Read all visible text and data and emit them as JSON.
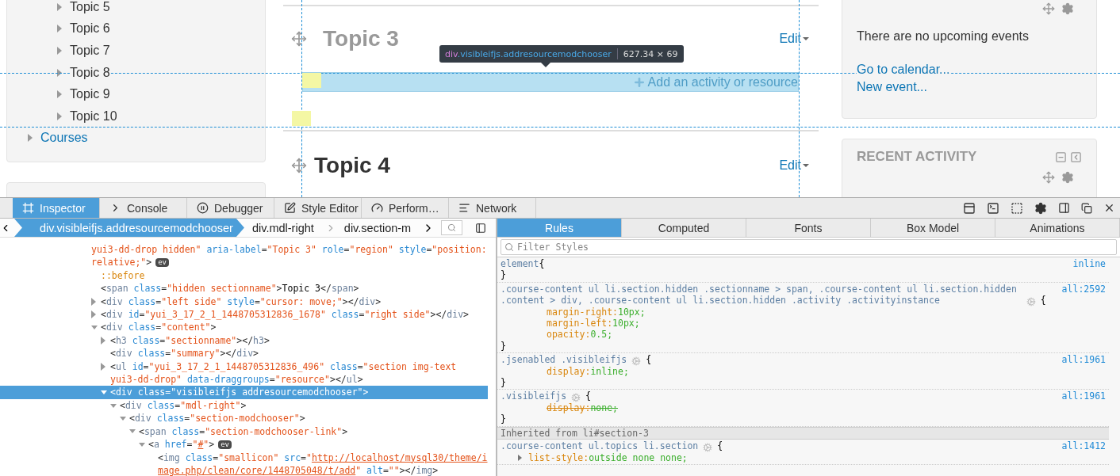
{
  "page": {
    "nav": {
      "topics": [
        {
          "label": "Topic 5",
          "expanded": false
        },
        {
          "label": "Topic 6",
          "expanded": false
        },
        {
          "label": "Topic 7",
          "expanded": false
        },
        {
          "label": "Topic 8",
          "expanded": false
        },
        {
          "label": "Topic 9",
          "expanded": false
        },
        {
          "label": "Topic 10",
          "expanded": false
        }
      ],
      "courses": {
        "label": "Courses",
        "expanded": false
      }
    },
    "sections": [
      {
        "title": "Topic 3",
        "hidden": true,
        "edit": "Edit",
        "add_activity": "Add an activity or resource"
      },
      {
        "title": "Topic 4",
        "hidden": false,
        "edit": "Edit"
      }
    ],
    "highlight": {
      "tag": "div",
      "classes": ".visibleifjs.addresourcemodchooser",
      "size": "627.34 × 69"
    },
    "blocks": [
      {
        "kind": "calendar",
        "message": "There are no upcoming events",
        "links": [
          "Go to calendar...",
          "New event..."
        ]
      },
      {
        "kind": "recent",
        "title": "RECENT ACTIVITY"
      }
    ]
  },
  "devtools": {
    "tools": [
      {
        "label": "Inspector",
        "selected": true
      },
      {
        "label": "Console",
        "selected": false
      },
      {
        "label": "Debugger",
        "selected": false
      },
      {
        "label": "Style Editor",
        "selected": false
      },
      {
        "label": "Perform…",
        "selected": false
      },
      {
        "label": "Network",
        "selected": false
      }
    ],
    "breadcrumbs": [
      {
        "label": "div.visibleifjs.addresourcemodchooser",
        "selected": true
      },
      {
        "label": "div.mdl-right",
        "selected": false
      },
      {
        "label": "div.section-m",
        "selected": false
      }
    ],
    "sidebar_tabs": [
      {
        "label": "Rules",
        "selected": true
      },
      {
        "label": "Computed",
        "selected": false
      },
      {
        "label": "Fonts",
        "selected": false
      },
      {
        "label": "Box Model",
        "selected": false
      },
      {
        "label": "Animations",
        "selected": false
      }
    ],
    "filter": {
      "placeholder": "Filter Styles"
    },
    "markup": {
      "parts": [
        {
          "kind": "value",
          "text": "yui3-dd-drop hidden\""
        },
        {
          "kind": "attr",
          "text": " aria-label"
        },
        {
          "kind": "punct",
          "text": "="
        },
        {
          "kind": "value",
          "text": "\"Topic 3\""
        },
        {
          "kind": "attr",
          "text": " role"
        },
        {
          "kind": "punct",
          "text": "="
        },
        {
          "kind": "value",
          "text": "\"region\""
        },
        {
          "kind": "attr",
          "text": " style"
        },
        {
          "kind": "punct",
          "text": "="
        },
        {
          "kind": "value",
          "text": "\"position: relative;\""
        },
        {
          "kind": "punct",
          "text": ">"
        },
        {
          "kind": "badge",
          "text": "ev"
        }
      ],
      "selected": false,
      "children": [
        {
          "parts": [
            {
              "kind": "pseudo",
              "text": "::before"
            }
          ],
          "selected": false
        },
        {
          "parts": [
            {
              "kind": "punct",
              "text": "<"
            },
            {
              "kind": "tag",
              "text": "span"
            },
            {
              "kind": "attr",
              "text": " class"
            },
            {
              "kind": "punct",
              "text": "="
            },
            {
              "kind": "value",
              "text": "\"hidden sectionname\""
            },
            {
              "kind": "punct",
              "text": ">"
            },
            {
              "kind": "text",
              "text": "Topic 3"
            },
            {
              "kind": "punct",
              "text": "</"
            },
            {
              "kind": "tag",
              "text": "span"
            },
            {
              "kind": "punct",
              "text": ">"
            }
          ],
          "selected": false
        },
        {
          "parts": [
            {
              "kind": "punct",
              "text": "<"
            },
            {
              "kind": "tag",
              "text": "div"
            },
            {
              "kind": "attr",
              "text": " class"
            },
            {
              "kind": "punct",
              "text": "="
            },
            {
              "kind": "value",
              "text": "\"left side\""
            },
            {
              "kind": "attr",
              "text": " style"
            },
            {
              "kind": "punct",
              "text": "="
            },
            {
              "kind": "value",
              "text": "\"cursor: move;\""
            },
            {
              "kind": "punct",
              "text": "></"
            },
            {
              "kind": "tag",
              "text": "div"
            },
            {
              "kind": "punct",
              "text": ">"
            }
          ],
          "expanded": false,
          "selected": false
        },
        {
          "parts": [
            {
              "kind": "punct",
              "text": "<"
            },
            {
              "kind": "tag",
              "text": "div"
            },
            {
              "kind": "attr",
              "text": " id"
            },
            {
              "kind": "punct",
              "text": "="
            },
            {
              "kind": "value",
              "text": "\"yui_3_17_2_1_1448705312836_1678\""
            },
            {
              "kind": "attr",
              "text": " class"
            },
            {
              "kind": "punct",
              "text": "="
            },
            {
              "kind": "value",
              "text": "\"right side\""
            },
            {
              "kind": "punct",
              "text": "></"
            },
            {
              "kind": "tag",
              "text": "div"
            },
            {
              "kind": "punct",
              "text": ">"
            }
          ],
          "expanded": false,
          "selected": false
        },
        {
          "parts": [
            {
              "kind": "punct",
              "text": "<"
            },
            {
              "kind": "tag",
              "text": "div"
            },
            {
              "kind": "attr",
              "text": " class"
            },
            {
              "kind": "punct",
              "text": "="
            },
            {
              "kind": "value",
              "text": "\"content\""
            },
            {
              "kind": "punct",
              "text": ">"
            }
          ],
          "expanded": true,
          "selected": false,
          "children": [
            {
              "parts": [
                {
                  "kind": "punct",
                  "text": "<"
                },
                {
                  "kind": "tag",
                  "text": "h3"
                },
                {
                  "kind": "attr",
                  "text": " class"
                },
                {
                  "kind": "punct",
                  "text": "="
                },
                {
                  "kind": "value",
                  "text": "\"sectionname\""
                },
                {
                  "kind": "punct",
                  "text": "></"
                },
                {
                  "kind": "tag",
                  "text": "h3"
                },
                {
                  "kind": "punct",
                  "text": ">"
                }
              ],
              "expanded": false,
              "selected": false
            },
            {
              "parts": [
                {
                  "kind": "punct",
                  "text": "<"
                },
                {
                  "kind": "tag",
                  "text": "div"
                },
                {
                  "kind": "attr",
                  "text": " class"
                },
                {
                  "kind": "punct",
                  "text": "="
                },
                {
                  "kind": "value",
                  "text": "\"summary\""
                },
                {
                  "kind": "punct",
                  "text": "></"
                },
                {
                  "kind": "tag",
                  "text": "div"
                },
                {
                  "kind": "punct",
                  "text": ">"
                }
              ],
              "selected": false
            },
            {
              "parts": [
                {
                  "kind": "punct",
                  "text": "<"
                },
                {
                  "kind": "tag",
                  "text": "ul"
                },
                {
                  "kind": "attr",
                  "text": " id"
                },
                {
                  "kind": "punct",
                  "text": "="
                },
                {
                  "kind": "value",
                  "text": "\"yui_3_17_2_1_1448705312836_496\""
                },
                {
                  "kind": "attr",
                  "text": " class"
                },
                {
                  "kind": "punct",
                  "text": "="
                },
                {
                  "kind": "value",
                  "text": "\"section img-text yui3-dd-drop\""
                },
                {
                  "kind": "attr",
                  "text": " data-draggroups"
                },
                {
                  "kind": "punct",
                  "text": "="
                },
                {
                  "kind": "value",
                  "text": "\"resource\""
                },
                {
                  "kind": "punct",
                  "text": "></"
                },
                {
                  "kind": "tag",
                  "text": "ul"
                },
                {
                  "kind": "punct",
                  "text": ">"
                }
              ],
              "expanded": false,
              "selected": false
            },
            {
              "parts": [
                {
                  "kind": "punct",
                  "text": "<"
                },
                {
                  "kind": "tag",
                  "text": "div"
                },
                {
                  "kind": "attr",
                  "text": " class"
                },
                {
                  "kind": "punct",
                  "text": "="
                },
                {
                  "kind": "value",
                  "text": "\"visibleifjs addresourcemodchooser\""
                },
                {
                  "kind": "punct",
                  "text": ">"
                }
              ],
              "expanded": true,
              "selected": true,
              "children": [
                {
                  "parts": [
                    {
                      "kind": "punct",
                      "text": "<"
                    },
                    {
                      "kind": "tag",
                      "text": "div"
                    },
                    {
                      "kind": "attr",
                      "text": " class"
                    },
                    {
                      "kind": "punct",
                      "text": "="
                    },
                    {
                      "kind": "value",
                      "text": "\"mdl-right\""
                    },
                    {
                      "kind": "punct",
                      "text": ">"
                    }
                  ],
                  "expanded": true,
                  "selected": false,
                  "children": [
                    {
                      "parts": [
                        {
                          "kind": "punct",
                          "text": "<"
                        },
                        {
                          "kind": "tag",
                          "text": "div"
                        },
                        {
                          "kind": "attr",
                          "text": " class"
                        },
                        {
                          "kind": "punct",
                          "text": "="
                        },
                        {
                          "kind": "value",
                          "text": "\"section-modchooser\""
                        },
                        {
                          "kind": "punct",
                          "text": ">"
                        }
                      ],
                      "expanded": true,
                      "selected": false,
                      "children": [
                        {
                          "parts": [
                            {
                              "kind": "punct",
                              "text": "<"
                            },
                            {
                              "kind": "tag",
                              "text": "span"
                            },
                            {
                              "kind": "attr",
                              "text": " class"
                            },
                            {
                              "kind": "punct",
                              "text": "="
                            },
                            {
                              "kind": "value",
                              "text": "\"section-modchooser-link\""
                            },
                            {
                              "kind": "punct",
                              "text": ">"
                            }
                          ],
                          "expanded": true,
                          "selected": false,
                          "children": [
                            {
                              "parts": [
                                {
                                  "kind": "punct",
                                  "text": "<"
                                },
                                {
                                  "kind": "tag",
                                  "text": "a"
                                },
                                {
                                  "kind": "attr",
                                  "text": " href"
                                },
                                {
                                  "kind": "punct",
                                  "text": "="
                                },
                                {
                                  "kind": "value",
                                  "text": "\""
                                },
                                {
                                  "kind": "link",
                                  "text": "#"
                                },
                                {
                                  "kind": "value",
                                  "text": "\""
                                },
                                {
                                  "kind": "punct",
                                  "text": ">"
                                },
                                {
                                  "kind": "badge",
                                  "text": "ev"
                                }
                              ],
                              "expanded": true,
                              "selected": false,
                              "children": [
                                {
                                  "parts": [
                                    {
                                      "kind": "punct",
                                      "text": "<"
                                    },
                                    {
                                      "kind": "tag",
                                      "text": "img"
                                    },
                                    {
                                      "kind": "attr",
                                      "text": " class"
                                    },
                                    {
                                      "kind": "punct",
                                      "text": "="
                                    },
                                    {
                                      "kind": "value",
                                      "text": "\"smallicon\""
                                    },
                                    {
                                      "kind": "attr",
                                      "text": " src"
                                    },
                                    {
                                      "kind": "punct",
                                      "text": "="
                                    },
                                    {
                                      "kind": "value",
                                      "text": "\""
                                    },
                                    {
                                      "kind": "link",
                                      "text": "http://localhost/mysql30/theme/image.php/clean/core/1448705048/t/add"
                                    },
                                    {
                                      "kind": "value",
                                      "text": "\""
                                    },
                                    {
                                      "kind": "attr",
                                      "text": " alt"
                                    },
                                    {
                                      "kind": "punct",
                                      "text": "="
                                    },
                                    {
                                      "kind": "value",
                                      "text": "\"\""
                                    },
                                    {
                                      "kind": "punct",
                                      "text": "></"
                                    },
                                    {
                                      "kind": "tag",
                                      "text": "img"
                                    },
                                    {
                                      "kind": "punct",
                                      "text": ">"
                                    }
                                  ],
                                  "selected": false
                                }
                              ]
                            }
                          ]
                        }
                      ]
                    }
                  ]
                }
              ]
            }
          ]
        }
      ]
    },
    "rules": [
      {
        "kind": "rule",
        "selector": "element",
        "gear": false,
        "open": "{",
        "close": "}",
        "source": "inline"
      },
      {
        "kind": "rule",
        "selector": ".course-content ul li.section.hidden .sectionname > span, .course-content ul li.section.hidden .content > div, .course-content ul li.section.hidden .activity .activityinstance",
        "gear": true,
        "open": "{",
        "close": "}",
        "source": "all:2592",
        "declarations": [
          {
            "property": "margin-right:",
            "value": "10px;",
            "overridden": false
          },
          {
            "property": "margin-left:",
            "value": "10px;",
            "overridden": false
          },
          {
            "property": "opacity:",
            "value": "0.5;",
            "overridden": false
          }
        ]
      },
      {
        "kind": "rule",
        "selector": ".jsenabled .visibleifjs",
        "gear": true,
        "open": "{",
        "close": "}",
        "source": "all:1961",
        "declarations": [
          {
            "property": "display:",
            "value": "inline;",
            "overridden": false
          }
        ]
      },
      {
        "kind": "rule",
        "selector": ".visibleifjs",
        "gear": true,
        "open": "{",
        "close": "}",
        "source": "all:1961",
        "declarations": [
          {
            "property": "display:",
            "value": "none;",
            "overridden": true
          }
        ]
      },
      {
        "kind": "header",
        "text": "Inherited from li#section-3"
      },
      {
        "kind": "rule",
        "selector": ".course-content ul.topics li.section",
        "gear": true,
        "open": "{",
        "source": "all:1412",
        "declarations": [
          {
            "property": "list-style:",
            "value": "outside none none;",
            "overridden": false,
            "expanded": false
          }
        ]
      }
    ]
  }
}
